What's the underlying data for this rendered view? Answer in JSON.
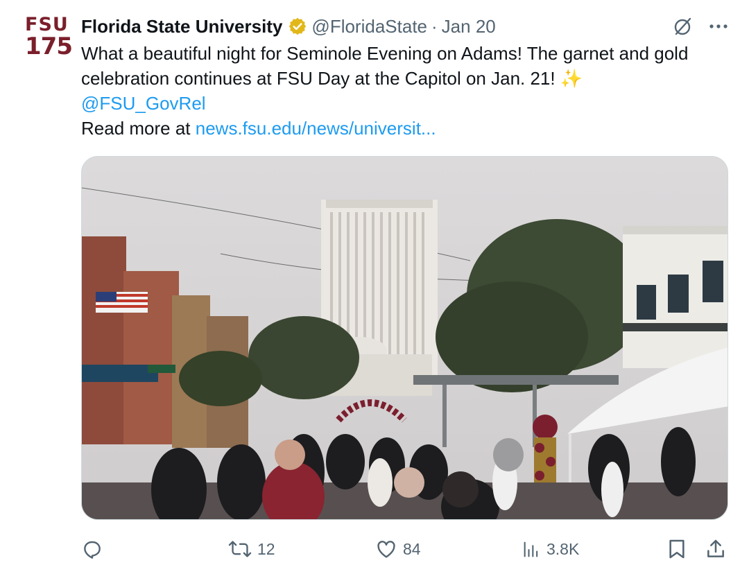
{
  "account": {
    "avatar_line1": "FSU",
    "avatar_line2": "175",
    "name": "Florida State University",
    "handle": "@FloridaState",
    "separator": "·",
    "date": "Jan 20"
  },
  "tweet": {
    "text_1": "What a beautiful night for Seminole Evening on Adams! The garnet and gold celebration continues at FSU Day at the Capitol on Jan. 21! ",
    "sparkle": "✨",
    "mention": "@FSU_GovRel",
    "readmore_prefix": "Read more at ",
    "link_text": "news.fsu.edu/news/universit..."
  },
  "media": {
    "description_icon": "photo"
  },
  "actions": {
    "replies": "",
    "retweets": "12",
    "likes": "84",
    "views": "3.8K"
  },
  "icons": [
    "grok-icon",
    "more-icon",
    "reply-icon",
    "retweet-icon",
    "like-icon",
    "views-icon",
    "bookmark-icon",
    "share-icon"
  ],
  "colors": {
    "text": "#0f1419",
    "muted": "#536471",
    "link": "#1d9bf0",
    "brand_garnet": "#7a1f2b",
    "verified_gold": "#e2b719"
  }
}
